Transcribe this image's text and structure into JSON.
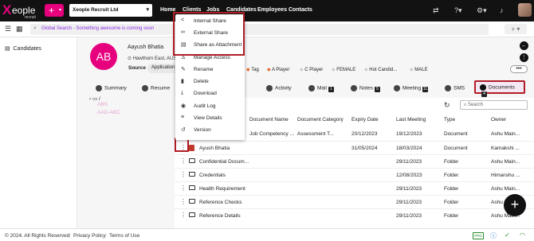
{
  "topbar": {
    "logo_text": "eople",
    "logo_sub": "recruit",
    "company": "Xeople Recruit Ltd",
    "nav": [
      "Home",
      "Clients",
      "Jobs",
      "Candidates",
      "Employees",
      "Contacts"
    ]
  },
  "search": {
    "text": "Global Search - Something awesome is coming soon"
  },
  "sidebar": {
    "item": "Candidates"
  },
  "header": {
    "initials": "AB",
    "name": "Aayush Bhatia",
    "address": "Hawthorn East, AUSTR",
    "source_label": "Source",
    "source_value": "Application",
    "tags": [
      "Tag",
      "A Player",
      "C Player",
      "FEMALE",
      "Hot Candid...",
      "MALE"
    ]
  },
  "tabs": [
    {
      "label": "Summary"
    },
    {
      "label": "Resume"
    },
    {
      "label": "Activity"
    },
    {
      "label": "Mail",
      "badge": "1"
    },
    {
      "label": "Notes",
      "badge": "5"
    },
    {
      "label": "Meeting",
      "badge": "11"
    },
    {
      "label": "SMS"
    },
    {
      "label": "Documents",
      "badge": "4"
    }
  ],
  "tree": {
    "root": "/",
    "ghost1": "ABS",
    "ghost2": "AAD-ABC"
  },
  "table": {
    "search_placeholder": "Search",
    "columns": [
      "Document Name",
      "Document Category",
      "Expiry Date",
      "Last Meeting",
      "Type",
      "Owner"
    ],
    "rows": [
      {
        "name": "Job Competency ...",
        "category": "Assessment T...",
        "expiry": "20/12/2023",
        "last": "19/12/2023",
        "type": "Document",
        "owner": "Ashu Main..."
      },
      {
        "name": "Ayush Bhatia",
        "category": "",
        "expiry": "31/05/2024",
        "last": "18/03/2024",
        "type": "Document",
        "owner": "Kamakshi ..."
      },
      {
        "name": "Confidential Docum...",
        "category": "",
        "expiry": "",
        "last": "29/11/2023",
        "type": "Folder",
        "owner": "Ashu Main..."
      },
      {
        "name": "Credentials",
        "category": "",
        "expiry": "",
        "last": "12/08/2023",
        "type": "Folder",
        "owner": "Himanshu ..."
      },
      {
        "name": "Health Requirement",
        "category": "",
        "expiry": "",
        "last": "29/11/2023",
        "type": "Folder",
        "owner": "Ashu Main..."
      },
      {
        "name": "Reference Checks",
        "category": "",
        "expiry": "",
        "last": "29/11/2023",
        "type": "Folder",
        "owner": "Ashu Main..."
      },
      {
        "name": "Reference Details",
        "category": "",
        "expiry": "",
        "last": "29/11/2023",
        "type": "Folder",
        "owner": "Ashu Main..."
      }
    ]
  },
  "menu": {
    "items": [
      "Internal Share",
      "External Share",
      "Share as Attachment",
      "Manage Access",
      "Rename",
      "Delete",
      "Download",
      "Audit Log",
      "View Details",
      "Version"
    ]
  },
  "footer": {
    "copyright": "© 2024. All Rights Reserved",
    "privacy": "Privacy Policy",
    "terms": "Terms of Use",
    "badge": "PPD"
  }
}
